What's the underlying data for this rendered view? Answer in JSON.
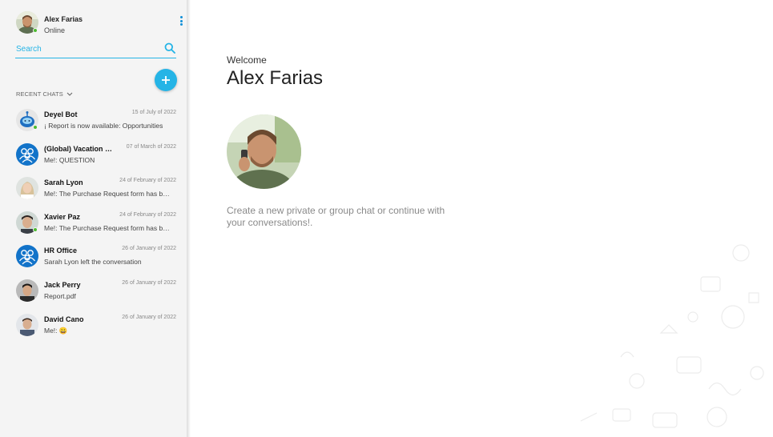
{
  "user": {
    "name": "Alex Farias",
    "status": "Online"
  },
  "search": {
    "placeholder": "Search"
  },
  "recent": {
    "header": "RECENT CHATS"
  },
  "chats": [
    {
      "name": "Deyel Bot",
      "date": "15 of July of 2022",
      "preview": "¡ Report is now available: Opportunities",
      "avatar": "bot-avatar",
      "online": true
    },
    {
      "name": "(Global) Vacation Requests",
      "date": "07 of March of 2022",
      "preview": "Me!: QUESTION",
      "avatar": "group-avatar",
      "online": false
    },
    {
      "name": "Sarah Lyon",
      "date": "24 of February of 2022",
      "preview": "Me!: The Purchase Request form has been updated",
      "avatar": "user-avatar",
      "online": false
    },
    {
      "name": "Xavier Paz",
      "date": "24 of February of 2022",
      "preview": "Me!: The Purchase Request form has been updated",
      "avatar": "user-avatar",
      "online": true
    },
    {
      "name": "HR Office",
      "date": "26 of January of 2022",
      "preview": "Sarah Lyon left the conversation",
      "avatar": "group-avatar",
      "online": false
    },
    {
      "name": "Jack Perry",
      "date": "26 of January of 2022",
      "preview": "Report.pdf",
      "avatar": "user-avatar",
      "online": false
    },
    {
      "name": "David Cano",
      "date": "26 of January of 2022",
      "preview": "Me!: 😀",
      "avatar": "user-avatar",
      "online": false
    }
  ],
  "main": {
    "welcome_label": "Welcome",
    "welcome_name": "Alex Farias",
    "info_text": "Create a new private or group chat or continue with your conversations!."
  },
  "colors": {
    "accent": "#25b4e6",
    "online": "#4cbb2f",
    "group": "#1273c9",
    "sidebar_bg": "#f4f4f4"
  }
}
